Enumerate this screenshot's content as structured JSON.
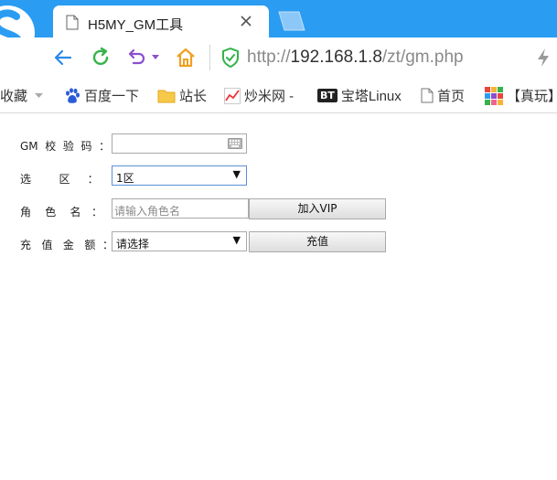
{
  "tab": {
    "title": "H5MY_GM工具"
  },
  "address": {
    "scheme": "http://",
    "host": "192.168.1.8",
    "path": "/zt/gm.php"
  },
  "bookmarks": [
    {
      "label": "收藏",
      "icon": "chevron-down-icon"
    },
    {
      "label": "百度一下",
      "icon": "baidu-paw-icon"
    },
    {
      "label": "站长",
      "icon": "folder-icon"
    },
    {
      "label": "炒米网 -",
      "icon": "chart-line-icon"
    },
    {
      "label": "宝塔Linux",
      "icon": "bt-badge-icon",
      "badge": "BT"
    },
    {
      "label": "首页",
      "icon": "page-icon"
    },
    {
      "label": "【真玩】",
      "icon": "colorful-grid-icon"
    }
  ],
  "form": {
    "gm_code": {
      "label": "GM  校  验  码  ：",
      "value": ""
    },
    "zone": {
      "label": "选        区     ：",
      "value": "1区"
    },
    "role": {
      "label": "角    色    名   ：",
      "placeholder": "请输入角色名",
      "button": "加入VIP"
    },
    "amount": {
      "label": "充   值   金   额  ：",
      "value": "请选择",
      "button": "充值"
    }
  },
  "colors": {
    "tabstrip": "#2a9cf2",
    "accent_green": "#34b34a",
    "accent_purple": "#8a4fcf",
    "home_orange": "#f0a020"
  }
}
